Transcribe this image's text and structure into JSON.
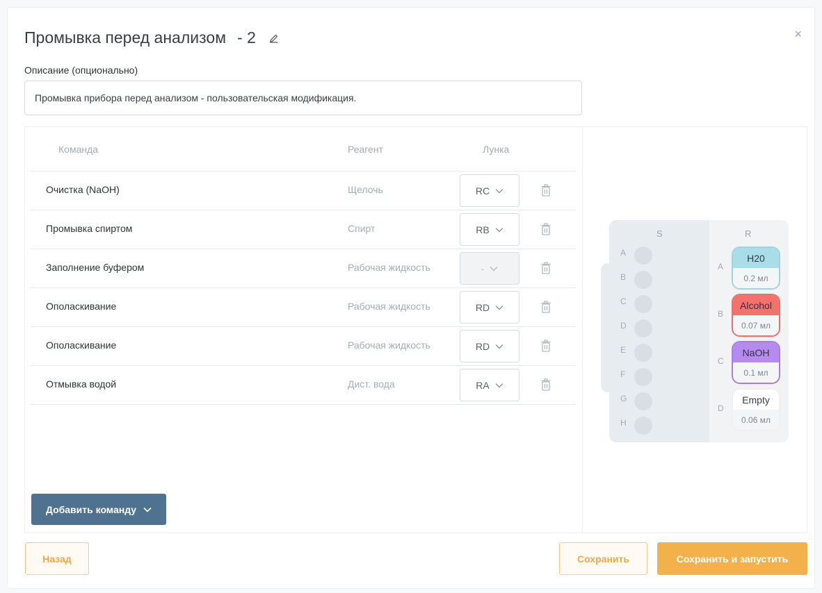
{
  "dialog": {
    "title": "Промывка перед анализом",
    "title_suffix": "- 2",
    "close_label": "×"
  },
  "description": {
    "label": "Описание (опционально)",
    "value": "Промывка прибора перед анализом - пользовательская модификация."
  },
  "table": {
    "headers": {
      "command": "Команда",
      "reagent": "Реагент",
      "well": "Лунка"
    },
    "rows": [
      {
        "command": "Очистка (NaOH)",
        "reagent": "Щелочь",
        "well": "RC",
        "disabled": false
      },
      {
        "command": "Промывка спиртом",
        "reagent": "Спирт",
        "well": "RB",
        "disabled": false
      },
      {
        "command": "Заполнение буфером",
        "reagent": "Рабочая жидкость",
        "well": "-",
        "disabled": true
      },
      {
        "command": "Ополаскивание",
        "reagent": "Рабочая жидкость",
        "well": "RD",
        "disabled": false
      },
      {
        "command": "Ополаскивание",
        "reagent": "Рабочая жидкость",
        "well": "RD",
        "disabled": false
      },
      {
        "command": "Отмывка водой",
        "reagent": "Дист. вода",
        "well": "RA",
        "disabled": false
      }
    ],
    "add_button": "Добавить команду"
  },
  "plate": {
    "s_header": "S",
    "r_header": "R",
    "s_rows": [
      "A",
      "B",
      "C",
      "D",
      "E",
      "F",
      "G",
      "H"
    ],
    "r_wells": [
      {
        "row": "A",
        "name": "H20",
        "volume": "0.2 мл",
        "color": "#a9dde8",
        "border": "#9fd3e1"
      },
      {
        "row": "B",
        "name": "Alcohol",
        "volume": "0.07 мл",
        "color": "#f4726e",
        "border": "#ef6e6a"
      },
      {
        "row": "C",
        "name": "NaOH",
        "volume": "0.1 мл",
        "color": "#b58bf0",
        "border": "#a77ee6"
      },
      {
        "row": "D",
        "name": "Empty",
        "volume": "0.06 мл",
        "color": "#ffffff",
        "border": "#eef0f2"
      }
    ]
  },
  "footer": {
    "back": "Назад",
    "save": "Сохранить",
    "save_run": "Сохранить и запустить"
  }
}
